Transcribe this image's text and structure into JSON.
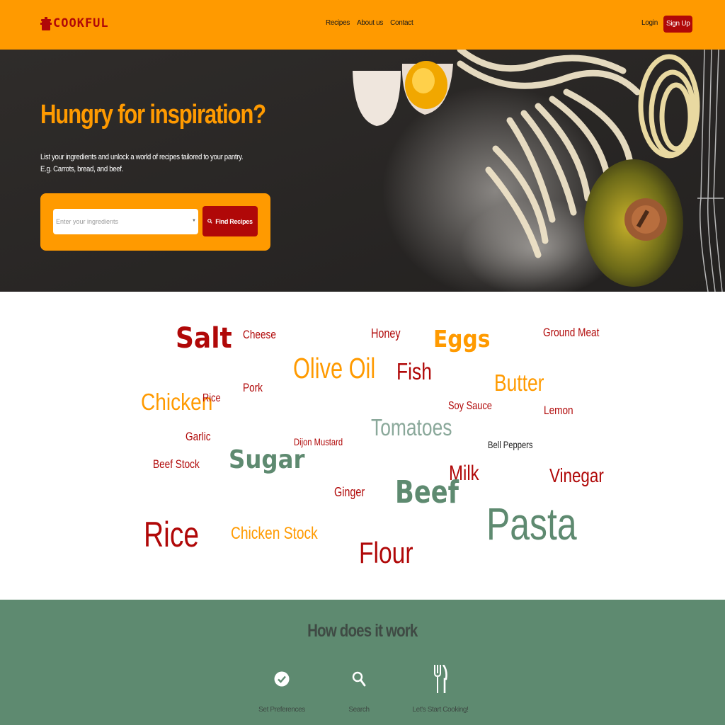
{
  "brand": {
    "name": "COOKFUL"
  },
  "nav": {
    "items": [
      "Recipes",
      "About us",
      "Contact"
    ]
  },
  "auth": {
    "login": "Login",
    "signup": "Sign Up"
  },
  "hero": {
    "title": "Hungry for inspiration?",
    "subtitle_line1": "List your ingredients and unlock a world of recipes tailored to your pantry.",
    "subtitle_line2": "E.g. Carrots, bread, and beef.",
    "search_placeholder": "Enter your ingredients",
    "find_button": "Find Recipes"
  },
  "colors": {
    "orange": "#ff9a00",
    "red": "#b00808",
    "green": "#5e8a70",
    "dark_text": "#3f4a44",
    "grey_green": "#8aa89a"
  },
  "word_cloud": [
    {
      "text": "Salt",
      "color": "#b00808",
      "weight": "bold"
    },
    {
      "text": "Cheese",
      "color": "#b00808",
      "weight": "normal"
    },
    {
      "text": "Honey",
      "color": "#b00808",
      "weight": "normal"
    },
    {
      "text": "Eggs",
      "color": "#ff9a00",
      "weight": "bold"
    },
    {
      "text": "Ground Meat",
      "color": "#b00808",
      "weight": "normal"
    },
    {
      "text": "Olive Oil",
      "color": "#ff9a00",
      "weight": "normal"
    },
    {
      "text": "Fish",
      "color": "#b00808",
      "weight": "normal"
    },
    {
      "text": "Pork",
      "color": "#b00808",
      "weight": "normal"
    },
    {
      "text": "Butter",
      "color": "#ff9a00",
      "weight": "normal"
    },
    {
      "text": "Chicken",
      "color": "#ff9a00",
      "weight": "normal"
    },
    {
      "text": "Rice",
      "color": "#b00808",
      "weight": "normal"
    },
    {
      "text": "Soy Sauce",
      "color": "#b00808",
      "weight": "normal"
    },
    {
      "text": "Lemon",
      "color": "#b00808",
      "weight": "normal"
    },
    {
      "text": "Tomatoes",
      "color": "#8aa89a",
      "weight": "normal"
    },
    {
      "text": "Garlic",
      "color": "#b00808",
      "weight": "normal"
    },
    {
      "text": "Dijon Mustard",
      "color": "#b00808",
      "weight": "normal"
    },
    {
      "text": "Bell Peppers",
      "color": "#1a1a1a",
      "weight": "normal"
    },
    {
      "text": "Sugar",
      "color": "#5e8a70",
      "weight": "bold"
    },
    {
      "text": "Beef Stock",
      "color": "#b00808",
      "weight": "normal"
    },
    {
      "text": "Milk",
      "color": "#b00808",
      "weight": "normal"
    },
    {
      "text": "Vinegar",
      "color": "#b00808",
      "weight": "normal"
    },
    {
      "text": "Ginger",
      "color": "#b00808",
      "weight": "normal"
    },
    {
      "text": "Beef",
      "color": "#5e8a70",
      "weight": "bold"
    },
    {
      "text": "Pasta",
      "color": "#5e8a70",
      "weight": "normal"
    },
    {
      "text": "Rice",
      "color": "#b00808",
      "weight": "normal"
    },
    {
      "text": "Chicken Stock",
      "color": "#ff9a00",
      "weight": "normal"
    },
    {
      "text": "Flour",
      "color": "#b00808",
      "weight": "normal"
    }
  ],
  "how": {
    "title": "How does it work",
    "steps": [
      {
        "label": "Set Preferences",
        "icon": "check-circle-icon"
      },
      {
        "label": "Search",
        "icon": "search-icon"
      },
      {
        "label": "Let's Start Cooking!",
        "icon": "utensils-icon"
      }
    ]
  }
}
